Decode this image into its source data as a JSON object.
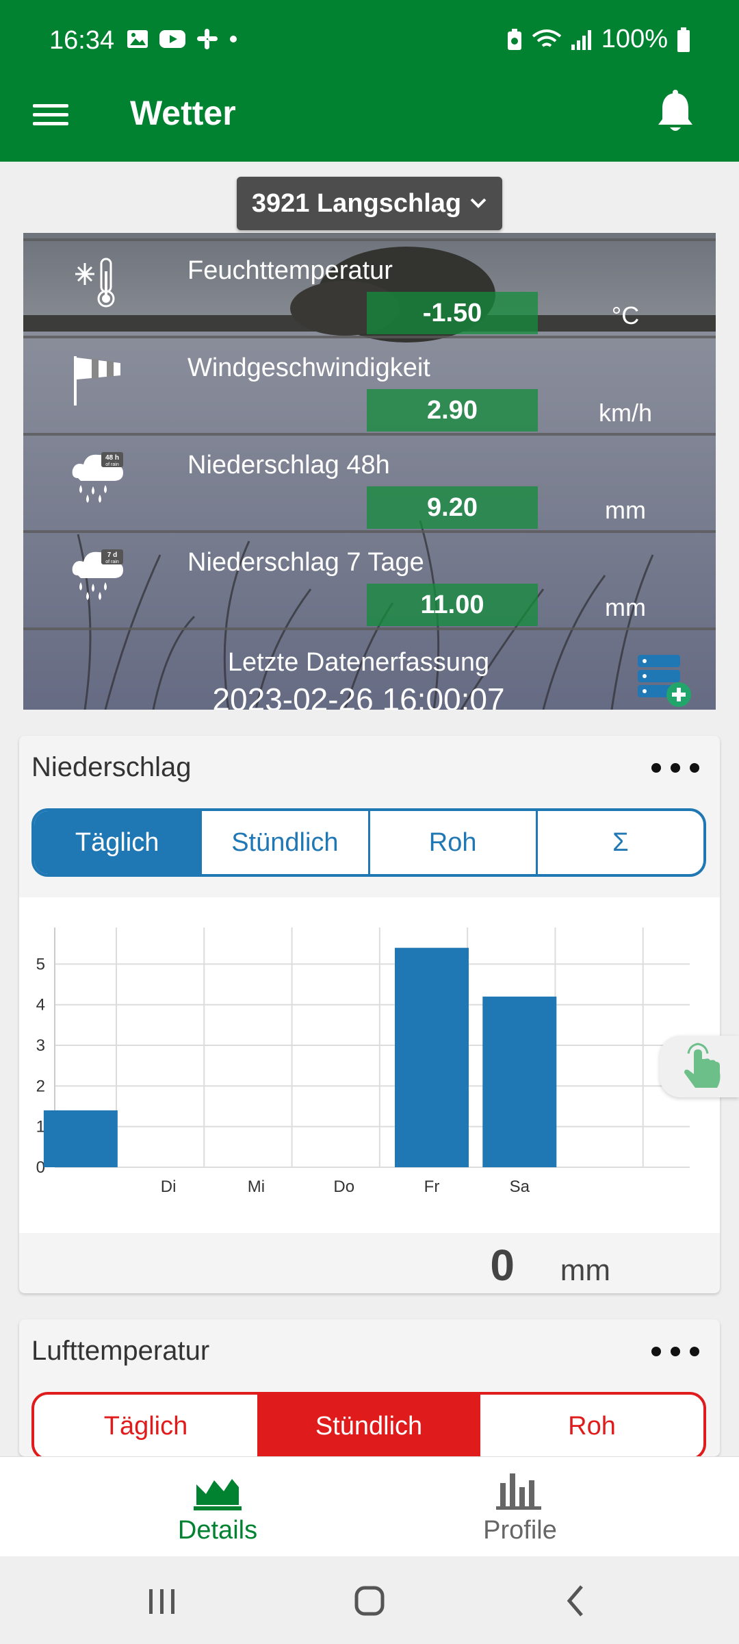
{
  "status_bar": {
    "time": "16:34",
    "battery": "100%"
  },
  "app_bar": {
    "title": "Wetter"
  },
  "location": {
    "selected": "3921 Langschlag"
  },
  "weather": {
    "rows": [
      {
        "label": "Feuchttemperatur",
        "value": "-1.50",
        "unit": "°C",
        "icon": "thermometer-snow-icon"
      },
      {
        "label": "Windgeschwindigkeit",
        "value": "2.90",
        "unit": "km/h",
        "icon": "windsock-icon"
      },
      {
        "label": "Niederschlag 48h",
        "value": "9.20",
        "unit": "mm",
        "icon": "rain-48h-icon"
      },
      {
        "label": "Niederschlag 7 Tage",
        "value": "11.00",
        "unit": "mm",
        "icon": "rain-7d-icon"
      }
    ],
    "rain_48_badge": "48 h",
    "rain_48_badge_sub": "of rain",
    "rain_7_badge": "7 d",
    "rain_7_badge_sub": "of rain",
    "last_data_label": "Letzte Datenerfassung",
    "last_data_value": "2023-02-26 16:00:07"
  },
  "precip_card": {
    "title": "Niederschlag",
    "tabs": [
      "Täglich",
      "Stündlich",
      "Roh",
      "Σ"
    ],
    "active_tab": 0,
    "total_value": "0",
    "total_unit": "mm"
  },
  "temp_card": {
    "title": "Lufttemperatur",
    "tabs": [
      "Täglich",
      "Stündlich",
      "Roh"
    ],
    "active_tab": 1
  },
  "chart_data": {
    "type": "bar",
    "categories": [
      "",
      "Di",
      "Mi",
      "Do",
      "Fr",
      "Sa",
      ""
    ],
    "values": [
      1.4,
      0,
      0,
      0,
      5.4,
      4.2,
      0
    ],
    "yticks": [
      0,
      1,
      2,
      3,
      4,
      5
    ],
    "ylim": [
      0,
      5.9
    ],
    "color": "#1f77b4",
    "grid": true
  },
  "bottom_nav": {
    "items": [
      {
        "label": "Details",
        "active": true
      },
      {
        "label": "Profile",
        "active": false
      }
    ]
  },
  "colors": {
    "brand_green": "#018231",
    "chart_blue": "#1f77b4",
    "temp_red": "#e01b1b"
  }
}
